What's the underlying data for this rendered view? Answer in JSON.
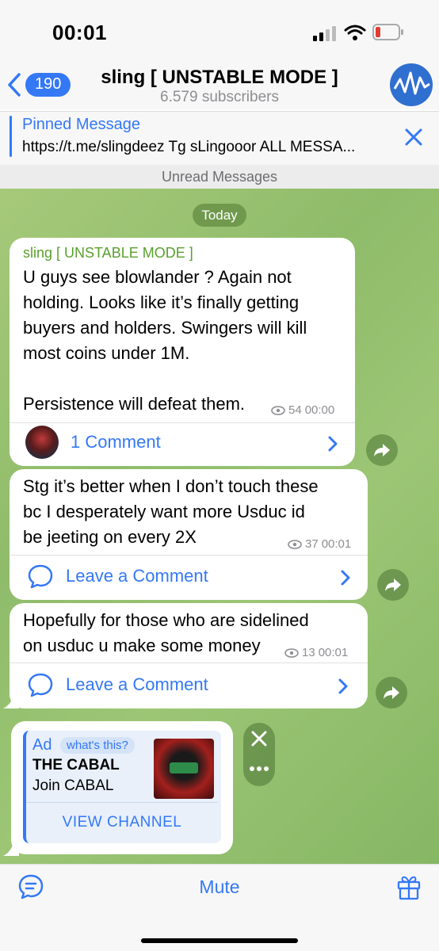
{
  "status": {
    "time": "00:01"
  },
  "header": {
    "back_count": "190",
    "title": "sling [ UNSTABLE MODE ]",
    "subtitle": "6.579 subscribers"
  },
  "pinned": {
    "label": "Pinned Message",
    "text": "https://t.me/slingdeez Tg sLingooor ALL MESSA..."
  },
  "unread_label": "Unread Messages",
  "date_label": "Today",
  "messages": [
    {
      "author": "sling [ UNSTABLE MODE ]",
      "lines": [
        "U guys see blowlander ? Again not",
        "holding. Looks like it’s finally getting",
        "buyers and holders. Swingers will kill",
        "most coins under 1M.",
        "",
        "Persistence will defeat them."
      ],
      "views": "54",
      "time": "00:00",
      "comment_label": "1 Comment"
    },
    {
      "lines": [
        "Stg it’s better when I don’t touch these",
        "bc I desperately want more Usduc id",
        "be jeeting on every 2X"
      ],
      "views": "37",
      "time": "00:01",
      "comment_label": "Leave a Comment"
    },
    {
      "lines": [
        "Hopefully for those who are sidelined",
        "on usduc u make some money"
      ],
      "views": "13",
      "time": "00:01",
      "comment_label": "Leave a Comment"
    }
  ],
  "ad": {
    "tag": "Ad",
    "whats_this": "what's this?",
    "title": "THE CABAL",
    "subtitle": "Join CABAL",
    "button": "VIEW CHANNEL"
  },
  "bottom": {
    "mute_label": "Mute"
  },
  "colors": {
    "accent": "#3478f6",
    "bubble": "#ffffff",
    "author": "#5aa02c"
  }
}
